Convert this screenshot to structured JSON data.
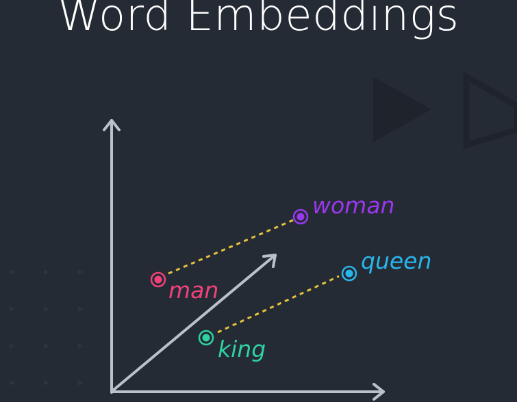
{
  "title": "Word Embeddings",
  "colors": {
    "background": "#252b35",
    "axis": "#b9c1cb",
    "dashed_line": "#e6c23b",
    "decor": "#1f242c",
    "decor_stroke": "#2c323c",
    "dots": "#2e343e"
  },
  "words": {
    "man": {
      "label": "man",
      "color": "#f0427a"
    },
    "woman": {
      "label": "woman",
      "color": "#9b37ef"
    },
    "king": {
      "label": "king",
      "color": "#2ed3a0"
    },
    "queen": {
      "label": "queen",
      "color": "#2ab5ea"
    }
  },
  "decor_icons": [
    "play-triangle-filled-icon",
    "play-triangle-outline-icon"
  ]
}
